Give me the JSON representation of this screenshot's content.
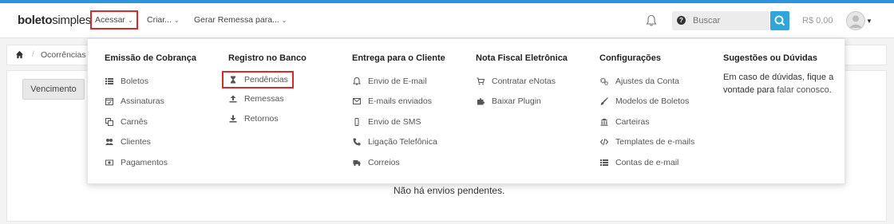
{
  "brand": {
    "bold": "boleto",
    "light": "simples"
  },
  "nav": {
    "acessar": "Acessar",
    "criar": "Criar...",
    "remessa": "Gerar Remessa para..."
  },
  "search": {
    "placeholder": "Buscar"
  },
  "balance": "R$ 0,00",
  "breadcrumb": {
    "current": "Ocorrências pe"
  },
  "filter": {
    "vencimento": "Vencimento"
  },
  "empty_message": "Não há envios pendentes.",
  "menu": {
    "col1": {
      "title": "Emissão de Cobrança",
      "items": [
        {
          "label": "Boletos",
          "icon": "list-icon"
        },
        {
          "label": "Assinaturas",
          "icon": "calendar-check-icon"
        },
        {
          "label": "Carnês",
          "icon": "copy-icon"
        },
        {
          "label": "Clientes",
          "icon": "users-icon"
        },
        {
          "label": "Pagamentos",
          "icon": "money-icon"
        }
      ]
    },
    "col2": {
      "title": "Registro no Banco",
      "items": [
        {
          "label": "Pendências",
          "icon": "hourglass-icon"
        },
        {
          "label": "Remessas",
          "icon": "upload-icon"
        },
        {
          "label": "Retornos",
          "icon": "download-icon"
        }
      ]
    },
    "col3": {
      "title": "Entrega para o Cliente",
      "items": [
        {
          "label": "Envio de E-mail",
          "icon": "bell-icon"
        },
        {
          "label": "E-mails enviados",
          "icon": "envelope-icon"
        },
        {
          "label": "Envio de SMS",
          "icon": "mobile-icon"
        },
        {
          "label": "Ligação Telefônica",
          "icon": "phone-icon"
        },
        {
          "label": "Correios",
          "icon": "truck-icon"
        }
      ]
    },
    "col4": {
      "title": "Nota Fiscal Eletrônica",
      "items": [
        {
          "label": "Contratar eNotas",
          "icon": "cart-icon"
        },
        {
          "label": "Baixar Plugin",
          "icon": "puzzle-icon"
        }
      ]
    },
    "col5": {
      "title": "Configurações",
      "items": [
        {
          "label": "Ajustes da Conta",
          "icon": "cogs-icon"
        },
        {
          "label": "Modelos de Boletos",
          "icon": "brush-icon"
        },
        {
          "label": "Carteiras",
          "icon": "bank-icon"
        },
        {
          "label": "Templates de e-mails",
          "icon": "code-icon"
        },
        {
          "label": "Contas de e-mail",
          "icon": "list-icon"
        }
      ]
    },
    "col6": {
      "title": "Sugestões ou Dúvidas",
      "text_before": "Em caso de dúvidas, fique a vontade para ",
      "link": "falar conosco",
      "text_after": "."
    }
  }
}
